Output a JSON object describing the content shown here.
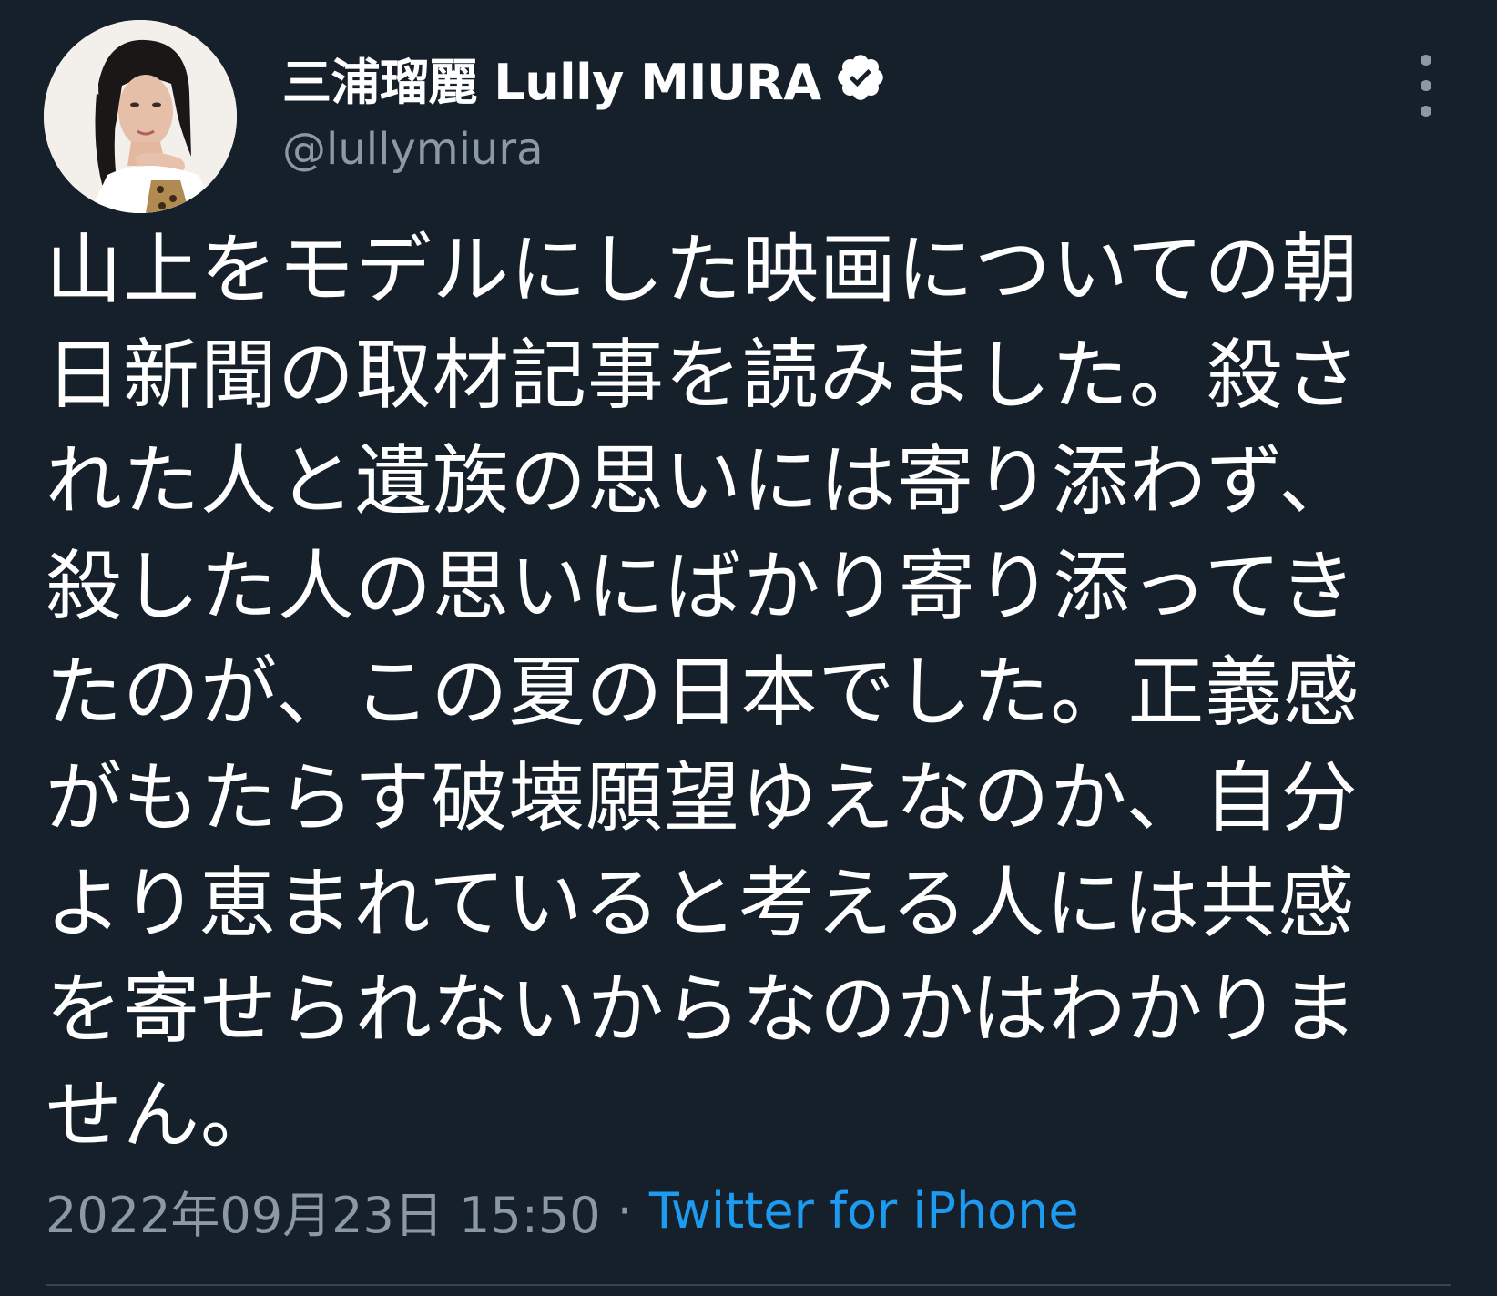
{
  "tweet": {
    "author": {
      "display_name": "三浦瑠麗 Lully MIURA",
      "handle": "@lullymiura",
      "verified": true
    },
    "text": "山上をモデルにした映画についての朝日新聞の取材記事を読みました。殺された人と遺族の思いには寄り添わず、殺した人の思いにばかり寄り添ってきたのが、この夏の日本でした。正義感がもたらす破壊願望ゆえなのか、自分より恵まれていると考える人には共感を寄せられないからなのかはわかりません。",
    "timestamp": "2022年09月23日 15:50",
    "separator": "·",
    "source": "Twitter for iPhone"
  },
  "icons": {
    "verified": "verified-badge-icon",
    "more": "more-vertical-icon"
  },
  "colors": {
    "background": "#15202b",
    "text_primary": "#ffffff",
    "text_secondary": "#8b98a5",
    "link": "#1d9bf0",
    "divider": "#38444d"
  }
}
